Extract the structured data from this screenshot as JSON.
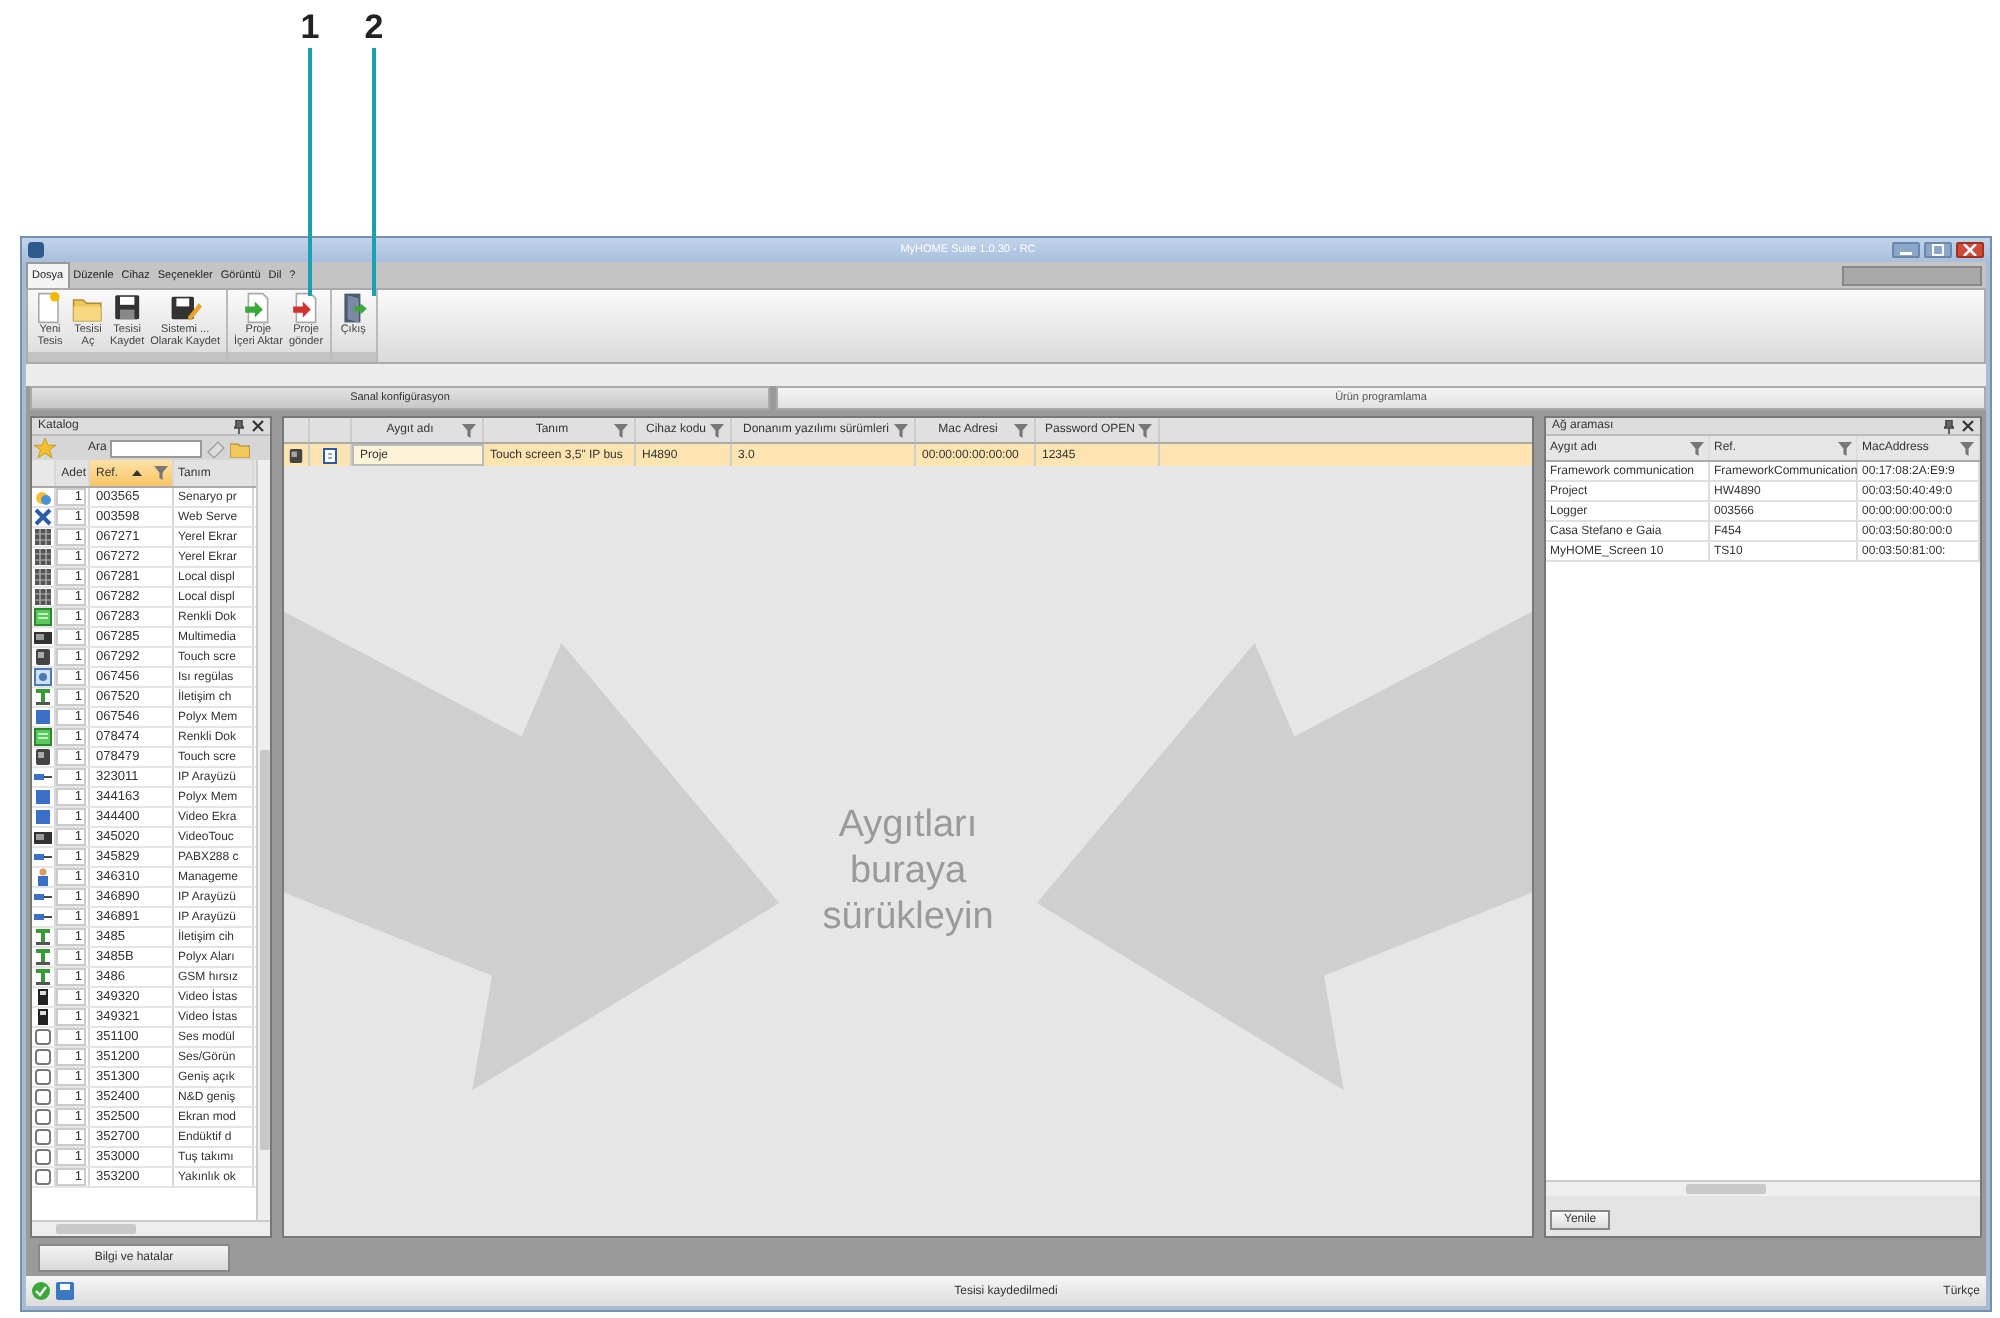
{
  "callouts": [
    "1",
    "2"
  ],
  "window": {
    "title": "MyHOME Suite 1.0.30 - RC"
  },
  "menu": [
    {
      "label": "Dosya",
      "selected": true
    },
    {
      "label": "Düzenle",
      "selected": false
    },
    {
      "label": "Cihaz",
      "selected": false
    },
    {
      "label": "Seçenekler",
      "selected": false
    },
    {
      "label": "Görüntü",
      "selected": false
    },
    {
      "label": "Dil",
      "selected": false
    },
    {
      "label": "?",
      "selected": false
    }
  ],
  "toolbar": [
    {
      "buttons": [
        {
          "label": "Yeni\nTesis",
          "kind": "new"
        },
        {
          "label": "Tesisi\nAç",
          "kind": "open"
        },
        {
          "label": "Tesisi\nKaydet",
          "kind": "save"
        },
        {
          "label": "Sistemi ...\nOlarak Kaydet",
          "kind": "saveas"
        }
      ]
    },
    {
      "buttons": [
        {
          "label": "Proje\nİçeri Aktar",
          "kind": "import"
        },
        {
          "label": "Proje\ngönder",
          "kind": "send"
        }
      ]
    },
    {
      "buttons": [
        {
          "label": "Çıkış",
          "kind": "exit"
        }
      ]
    }
  ],
  "view_tabs": [
    {
      "label": "Sanal konfigürasyon",
      "selected": true
    },
    {
      "label": "Ürün programlama",
      "selected": false
    }
  ],
  "catalog": {
    "title": "Katalog",
    "search_label": "Ara",
    "columns": [
      "Adet",
      "Ref.",
      "Tanım"
    ],
    "rows": [
      {
        "kind": "scenario",
        "qty": "1",
        "ref": "003565",
        "desc": "Senaryo pr"
      },
      {
        "kind": "web",
        "qty": "1",
        "ref": "003598",
        "desc": "Web Serve"
      },
      {
        "kind": "display",
        "qty": "1",
        "ref": "067271",
        "desc": "Yerel Ekrar"
      },
      {
        "kind": "display",
        "qty": "1",
        "ref": "067272",
        "desc": "Yerel Ekrar"
      },
      {
        "kind": "display",
        "qty": "1",
        "ref": "067281",
        "desc": "Local displ"
      },
      {
        "kind": "display",
        "qty": "1",
        "ref": "067282",
        "desc": "Local displ"
      },
      {
        "kind": "colordisplay",
        "qty": "1",
        "ref": "067283",
        "desc": "Renkli Dok"
      },
      {
        "kind": "photo",
        "qty": "1",
        "ref": "067285",
        "desc": "Multimedia"
      },
      {
        "kind": "touch",
        "qty": "1",
        "ref": "067292",
        "desc": "Touch scre"
      },
      {
        "kind": "thermo",
        "qty": "1",
        "ref": "067456",
        "desc": "Isı regülas"
      },
      {
        "kind": "intercom",
        "qty": "1",
        "ref": "067520",
        "desc": "İletişim ch"
      },
      {
        "kind": "module",
        "qty": "1",
        "ref": "067546",
        "desc": "Polyx Mem"
      },
      {
        "kind": "colordisplay",
        "qty": "1",
        "ref": "078474",
        "desc": "Renkli Dok"
      },
      {
        "kind": "touch",
        "qty": "1",
        "ref": "078479",
        "desc": "Touch scre"
      },
      {
        "kind": "network",
        "qty": "1",
        "ref": "323011",
        "desc": "IP Arayüzü"
      },
      {
        "kind": "module",
        "qty": "1",
        "ref": "344163",
        "desc": "Polyx Mem"
      },
      {
        "kind": "module",
        "qty": "1",
        "ref": "344400",
        "desc": "Video Ekra"
      },
      {
        "kind": "photo",
        "qty": "1",
        "ref": "345020",
        "desc": "VideoTouc"
      },
      {
        "kind": "network",
        "qty": "1",
        "ref": "345829",
        "desc": "PABX288 c"
      },
      {
        "kind": "person",
        "qty": "1",
        "ref": "346310",
        "desc": "Manageme"
      },
      {
        "kind": "network",
        "qty": "1",
        "ref": "346890",
        "desc": "IP Arayüzü"
      },
      {
        "kind": "network",
        "qty": "1",
        "ref": "346891",
        "desc": "IP Arayüzü"
      },
      {
        "kind": "intercom",
        "qty": "1",
        "ref": "3485",
        "desc": "İletişim cih"
      },
      {
        "kind": "intercom",
        "qty": "1",
        "ref": "3485B",
        "desc": "Polyx Aları"
      },
      {
        "kind": "intercom",
        "qty": "1",
        "ref": "3486",
        "desc": "GSM hırsız"
      },
      {
        "kind": "station",
        "qty": "1",
        "ref": "349320",
        "desc": "Video İstas"
      },
      {
        "kind": "station",
        "qty": "1",
        "ref": "349321",
        "desc": "Video İstas"
      },
      {
        "kind": "outline",
        "qty": "1",
        "ref": "351100",
        "desc": "Ses modül"
      },
      {
        "kind": "outline",
        "qty": "1",
        "ref": "351200",
        "desc": "Ses/Görün"
      },
      {
        "kind": "outline",
        "qty": "1",
        "ref": "351300",
        "desc": "Geniş açık"
      },
      {
        "kind": "outline",
        "qty": "1",
        "ref": "352400",
        "desc": "N&D geniş"
      },
      {
        "kind": "outline",
        "qty": "1",
        "ref": "352500",
        "desc": "Ekran mod"
      },
      {
        "kind": "outline",
        "qty": "1",
        "ref": "352700",
        "desc": "Endüktif d"
      },
      {
        "kind": "outline",
        "qty": "1",
        "ref": "353000",
        "desc": "Tuş takımı"
      },
      {
        "kind": "outline",
        "qty": "1",
        "ref": "353200",
        "desc": "Yakınlık ok"
      }
    ]
  },
  "project": {
    "columns": [
      "Aygıt adı",
      "Tanım",
      "Cihaz kodu",
      "Donanım yazılımı sürümleri",
      "Mac Adresi",
      "Password OPEN"
    ],
    "rows": [
      {
        "selected": true,
        "cells": [
          "Proje",
          "Touch screen 3,5\" IP bus",
          "H4890",
          "3.0",
          "00:00:00:00:00:00",
          "12345"
        ]
      }
    ],
    "drop_hint": "Aygıtları buraya sürükleyin"
  },
  "network": {
    "title": "Ağ araması",
    "columns": [
      "Aygıt adı",
      "Ref.",
      "MacAddress"
    ],
    "rows": [
      [
        "Framework communication",
        "FrameworkCommunication",
        "00:17:08:2A:E9:9"
      ],
      [
        "Project",
        "HW4890",
        "00:03:50:40:49:0"
      ],
      [
        "Logger",
        "003566",
        "00:00:00:00:00:0"
      ],
      [
        "Casa Stefano e Gaia",
        "F454",
        "00:03:50:80:00:0"
      ],
      [
        "MyHOME_Screen 10",
        "TS10",
        "00:03:50:81:00:"
      ]
    ],
    "refresh": "Yenile"
  },
  "info_button": "Bilgi ve hatalar",
  "status": {
    "message": "Tesisi kaydedilmedi",
    "language": "Türkçe"
  }
}
